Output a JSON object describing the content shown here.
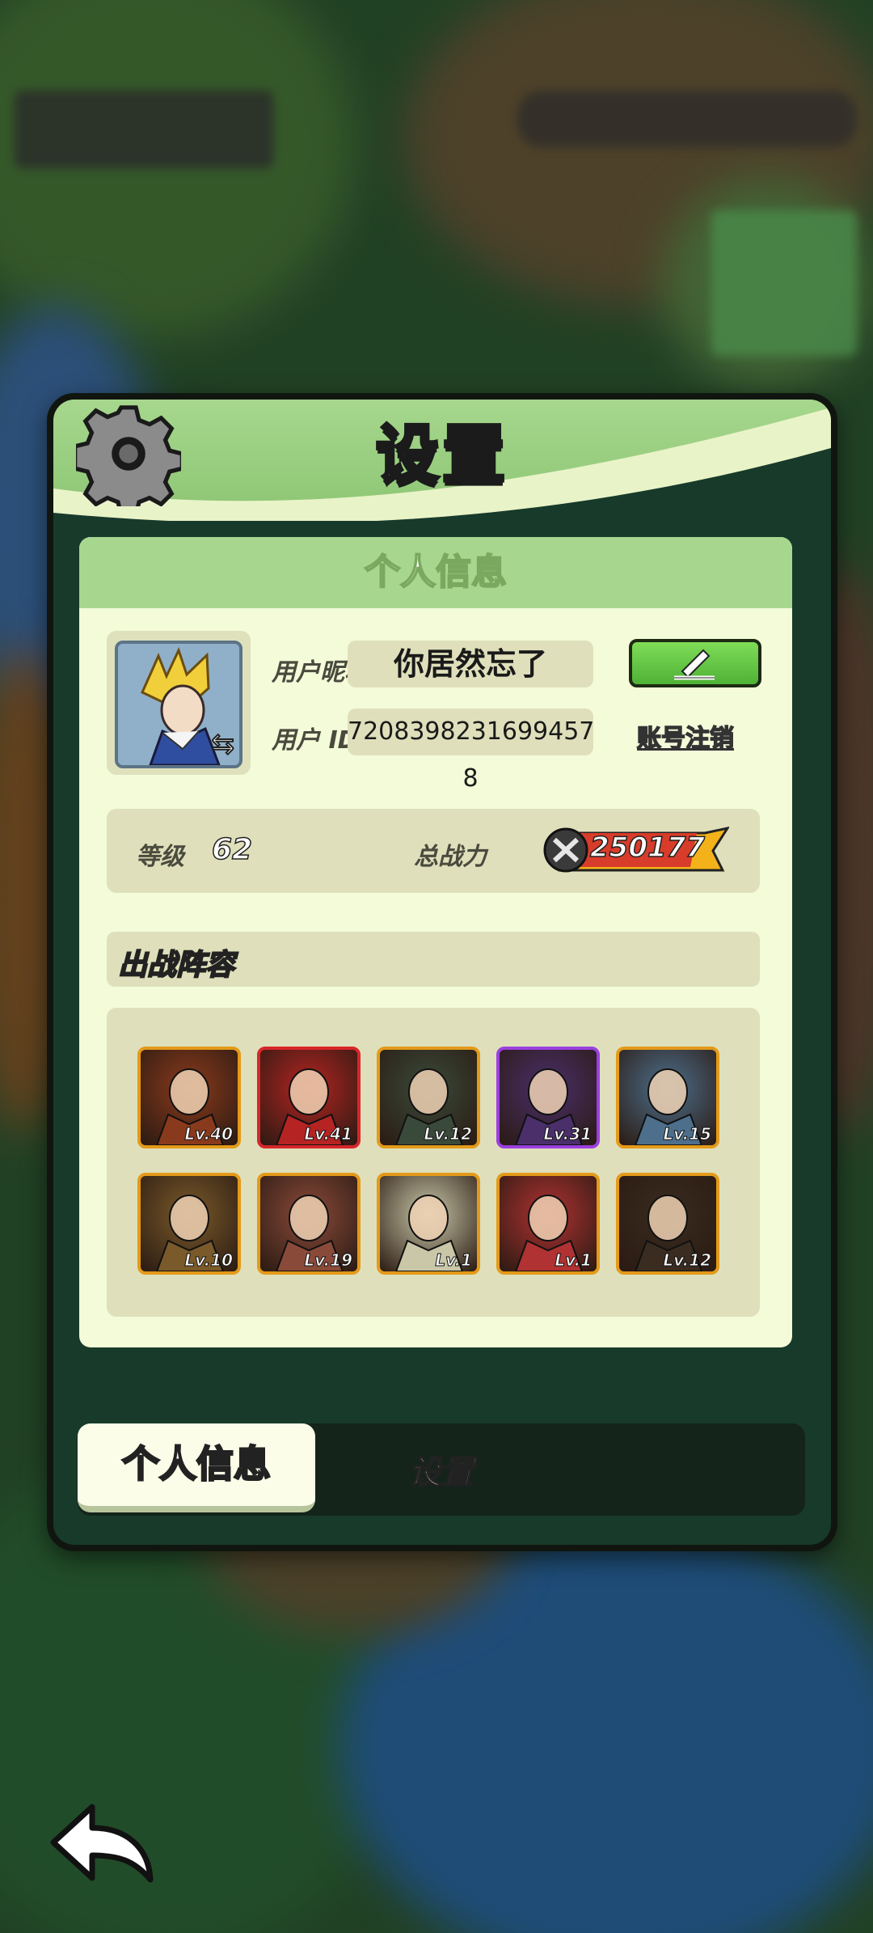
{
  "dialog": {
    "title": "设置",
    "section_header": "个人信息",
    "profile": {
      "nickname_label": "用户昵称",
      "nickname_value": "你居然忘了",
      "id_label": "用户 ID",
      "id_value": "7208398231699457​8",
      "cancel_account_label": "账号注销"
    },
    "stats": {
      "level_label": "等级",
      "level_value": "62",
      "power_label": "总战力",
      "power_value": "250177"
    },
    "lineup": {
      "title": "出战阵容",
      "heroes": [
        {
          "level": "Lv.40",
          "frame": "#e49a1a",
          "tone": "#8a3a1c"
        },
        {
          "level": "Lv.41",
          "frame": "#d8262a",
          "tone": "#b52422"
        },
        {
          "level": "Lv.12",
          "frame": "#e49a1a",
          "tone": "#3a4a3a"
        },
        {
          "level": "Lv.31",
          "frame": "#9b3fe0",
          "tone": "#4a2f6b"
        },
        {
          "level": "Lv.15",
          "frame": "#e49a1a",
          "tone": "#4d6f8c"
        },
        {
          "level": "Lv.10",
          "frame": "#e49a1a",
          "tone": "#7a5a2a"
        },
        {
          "level": "Lv.19",
          "frame": "#e49a1a",
          "tone": "#8a4a3a"
        },
        {
          "level": "Lv.1",
          "frame": "#e49a1a",
          "tone": "#c9c7a8"
        },
        {
          "level": "Lv.1",
          "frame": "#e49a1a",
          "tone": "#b03232"
        },
        {
          "level": "Lv.12",
          "frame": "#e49a1a",
          "tone": "#3a2c20"
        }
      ]
    },
    "tabs": {
      "active": "个人信息",
      "other": "设置"
    }
  },
  "colors": {
    "header_green": "#a6d78d",
    "panel_bg": "#f3fbd9",
    "button_green": "#5cc23e"
  }
}
